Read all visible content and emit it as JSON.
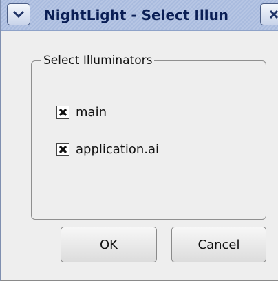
{
  "window": {
    "title": "NightLight - Select Illun"
  },
  "icons": {
    "window_menu": "chevron-down-icon",
    "close": "close-icon",
    "check": "checkmark-x-icon"
  },
  "colors": {
    "titlebar": "#b7c6e4",
    "title_text": "#0a1e55",
    "dialog_bg": "#eeeeee"
  },
  "group": {
    "title": "Select Illuminators",
    "items": [
      {
        "label": "main",
        "checked": true
      },
      {
        "label": "application.ai",
        "checked": true
      }
    ]
  },
  "buttons": {
    "ok": "OK",
    "cancel": "Cancel"
  }
}
